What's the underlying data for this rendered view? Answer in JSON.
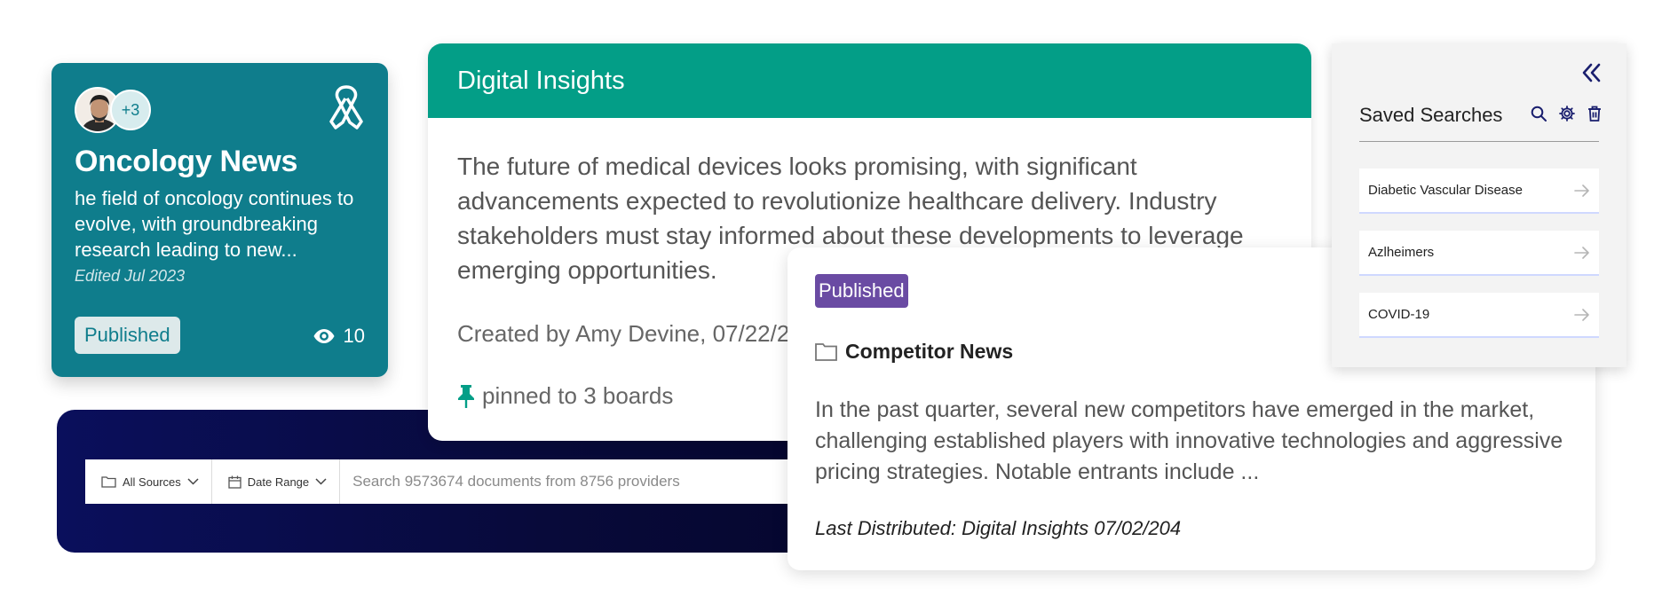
{
  "oncology_card": {
    "avatar_more": "+3",
    "title": "Oncology News",
    "description": "he field of oncology continues to evolve, with groundbreaking research leading to new...",
    "edited": "Edited Jul 2023",
    "status": "Published",
    "views": "10",
    "icons": [
      "awareness-ribbon-icon",
      "eye-icon"
    ],
    "colors": {
      "background": "#0f7d8c"
    }
  },
  "search": {
    "sources_label": "All Sources",
    "date_label": "Date Range",
    "placeholder": "Search 9573674 documents from 8756 providers",
    "icons": [
      "folder-icon",
      "calendar-icon",
      "chevron-down-icon"
    ]
  },
  "digital_insights": {
    "header": "Digital Insights",
    "body": "The future of medical devices looks promising, with significant advancements expected to revolutionize healthcare delivery. Industry stakeholders must stay informed about these developments to leverage emerging opportunities.",
    "created": "Created by Amy Devine, 07/22/20",
    "pinned": "pinned to 3 boards",
    "icons": [
      "pin-icon"
    ],
    "colors": {
      "header": "#039e87",
      "pin": "#039e87"
    }
  },
  "competitor_news": {
    "status": "Published",
    "title": "Competitor News",
    "body": "In the past quarter, several new competitors have emerged in the market, challenging established players with innovative technologies and aggressive pricing strategies. Notable entrants include ...",
    "last_distributed": "Last Distributed: Digital Insights 07/02/204",
    "icons": [
      "folder-icon"
    ],
    "colors": {
      "badge": "#6a4ba3"
    }
  },
  "saved_searches": {
    "title": "Saved Searches",
    "items": [
      {
        "label": "Diabetic Vascular Disease"
      },
      {
        "label": "Azlheimers"
      },
      {
        "label": "COVID-19"
      }
    ],
    "icons": [
      "double-chevron-left-icon",
      "search-icon",
      "gear-icon",
      "trash-icon",
      "arrow-right-icon"
    ],
    "colors": {
      "icons": "#1a1f6e"
    }
  }
}
